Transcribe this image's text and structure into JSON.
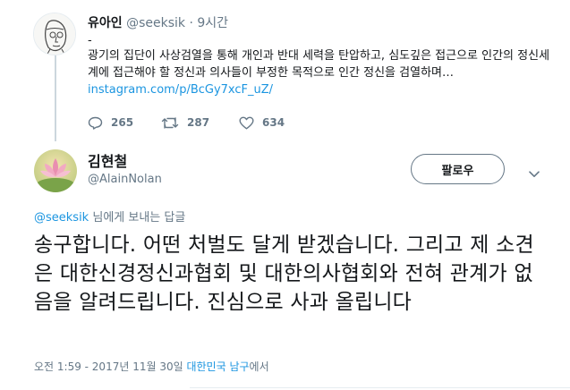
{
  "parent_tweet": {
    "name": "유아인",
    "handle": "@seeksik",
    "separator": "·",
    "time": "9시간",
    "dash": "-",
    "text": "광기의 집단이 사상검열을 통해 개인과 반대 세력을 탄압하고, 심도깊은 접근으로 인간의 정신세계에 접근해야 할 정신과 의사들이 부정한 목적으로 인간 정신을 검열하며…",
    "link": "instagram.com/p/BcGy7xcF_uZ/",
    "actions": {
      "reply_count": "265",
      "retweet_count": "287",
      "like_count": "634"
    }
  },
  "main_tweet": {
    "name": "김현철",
    "handle": "@AlainNolan",
    "follow_label": "팔로우",
    "reply_to_handle": "@seeksik",
    "reply_to_suffix": "님에게 보내는 답글",
    "text": "송구합니다. 어떤 처벌도 달게 받겠습니다. 그리고 제 소견은 대한신경정신과협회 및 대한의사협회와 전혀 관계가 없음을 알려드립니다. 진심으로 사과 올립니다",
    "timestamp": "오전 1:59 - 2017년 11월 30일",
    "location": "대한민국 남구",
    "location_suffix": "에서"
  },
  "colors": {
    "link_blue": "#1b95e0",
    "muted_gray": "#657786",
    "text_dark": "#14171a",
    "border": "#e6ecf0"
  },
  "icons": [
    "reply-icon",
    "retweet-icon",
    "like-icon",
    "chevron-down-icon"
  ]
}
